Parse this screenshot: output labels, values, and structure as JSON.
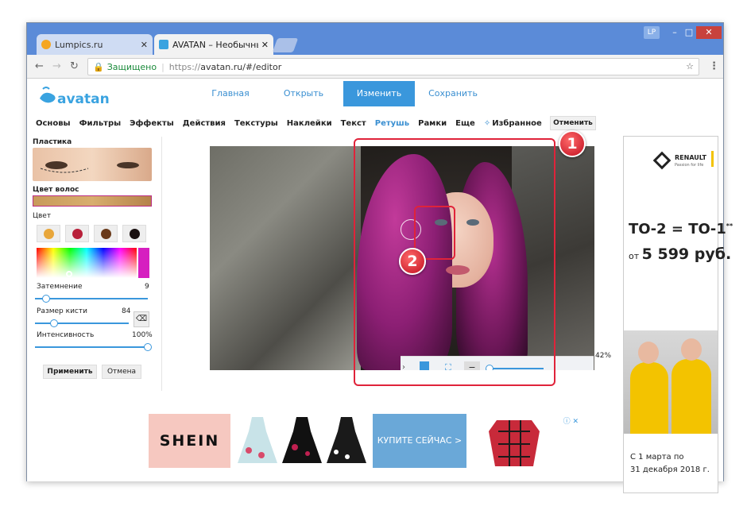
{
  "browser": {
    "tabs": [
      {
        "title": "Lumpics.ru",
        "active": false
      },
      {
        "title": "AVATAN – Необычный ф",
        "active": true
      }
    ],
    "window_controls": {
      "profile": "LP",
      "minimize": "–",
      "maximize": "□",
      "close": "✕"
    },
    "address": {
      "secure_label": "Защищено",
      "url_scheme": "https://",
      "url_rest": "avatan.ru/#/editor"
    }
  },
  "app": {
    "logo": "avatan",
    "nav": {
      "home": "Главная",
      "open": "Открыть",
      "edit": "Изменить",
      "save": "Сохранить"
    },
    "menu": [
      "Основы",
      "Фильтры",
      "Эффекты",
      "Действия",
      "Текстуры",
      "Наклейки",
      "Текст",
      "Ретушь",
      "Рамки",
      "Еще",
      "Избранное"
    ],
    "active_menu": "Ретушь",
    "cancel_top": "Отменить"
  },
  "panel": {
    "plastic_label": "Пластика",
    "hair_color_label": "Цвет волос",
    "color_label": "Цвет",
    "shading_label": "Затемнение",
    "shading_value": "9",
    "brush_label": "Размер кисти",
    "brush_value": "84",
    "intensity_label": "Интенсивность",
    "intensity_value": "100%",
    "apply": "Применить",
    "cancel": "Отмена",
    "shading_level": 0.1,
    "brush_level": 0.2,
    "intensity_level": 1.0
  },
  "canvas": {
    "zoom": "42%",
    "zoom_level": 0.05
  },
  "callouts": {
    "one": "1",
    "two": "2"
  },
  "ads": {
    "shein": "SHEIN",
    "buy_now": "КУПИТЕ СЕЙЧАС >",
    "renault_brand": "RENAULT",
    "renault_sub": "Passion for life",
    "renault_line1": "ТО-2 = ТО-1",
    "renault_star": "**",
    "renault_from": "от",
    "renault_price": "5 599 руб.",
    "renault_date1": "С 1 марта по",
    "renault_date2": "31 декабря 2018 г."
  },
  "colors": {
    "accent": "#3a97dc",
    "callout": "#e0233a",
    "hair": "#b3298c"
  }
}
